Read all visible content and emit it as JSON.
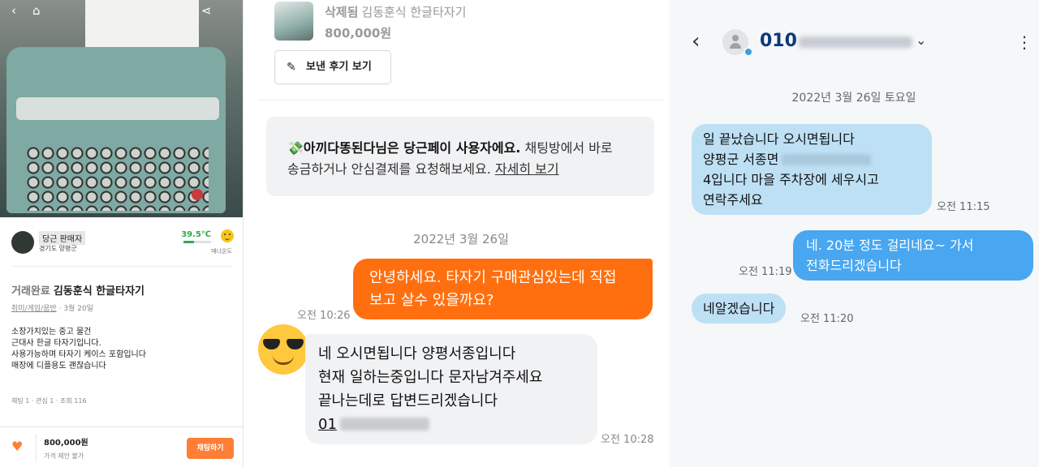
{
  "listing": {
    "seller_name": "당근 판매자",
    "seller_location": "경기도 양평군",
    "temperature": "39.5℃",
    "temperature_fraction": 0.395,
    "manner_label": "매너온도",
    "status": "거래완료",
    "title": "김동훈식 한글타자기",
    "category": "취미/게임/음반",
    "date": " · 3월 20일",
    "description": [
      "소장가치있는 중고 물건",
      "근대사 한글 타자기입니다.",
      "사용가능하며 타자기 케이스 포함입니다",
      "매장에 디플용도 괜찮습니다"
    ],
    "stats": "채팅 1 · 관심 1 · 조회 116",
    "price": "800,000원",
    "negotiation": "가격 제안 불가",
    "chat_button": "채팅하기"
  },
  "chat": {
    "deleted_label": "삭제됨",
    "item_name": "김동훈식 한글타자기",
    "item_price": "800,000원",
    "review_button": "보낸 후기 보기",
    "notice_bold": "아끼다똥된다님은 당근페이 사용자에요.",
    "notice_text1": " 채팅방에서 바로",
    "notice_text2": "송금하거나 안심결제를 요청해보세요. ",
    "notice_link": "자세히 보기",
    "date": "2022년 3월 26일",
    "outgoing_line1": "안녕하세요. 타자기 구매관심있는데 직접",
    "outgoing_line2": "보고 살수 있을까요?",
    "outgoing_time": "오전 10:26",
    "incoming_line1": "네 오시면됩니다 양평서종입니다",
    "incoming_line2": "현재  일하는중입니다  문자남겨주세요",
    "incoming_line3": "끝나는데로 답변드리겠습니다",
    "incoming_line4": "01",
    "incoming_time": "오전 10:28"
  },
  "sms": {
    "contact": "010",
    "date": "2022년 3월 26일 토요일",
    "msg1_line1": "일 끝났습니다 오시면됩니다",
    "msg1_line2": "양평군 서종면",
    "msg1_line3": "4입니다 마을 주차장에 세우시고",
    "msg1_line4": "연락주세요",
    "msg1_time": "오전 11:15",
    "msg2_line1": "네. 20분 정도 걸리네요~ 가서",
    "msg2_line2": "전화드리겠습니다",
    "msg2_time": "오전 11:19",
    "msg3": "네알겠습니다",
    "msg3_time": "오전 11:20"
  },
  "colors": {
    "accent": "#ff6f0f",
    "incoming_sms": "#bee0f5",
    "outgoing_sms": "#48a7f0",
    "temperature": "#32a852"
  },
  "icons": [
    "back-icon",
    "home-icon",
    "share-icon",
    "heart-icon",
    "pencil-icon",
    "chevron-left-icon",
    "chevron-down-icon",
    "more-vert-icon",
    "sunglasses-emoji-icon",
    "person-icon"
  ]
}
